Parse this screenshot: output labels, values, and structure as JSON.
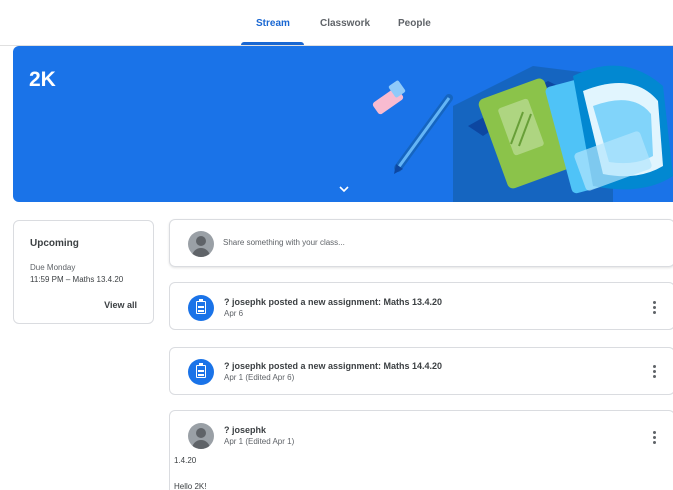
{
  "nav": {
    "tabs": [
      {
        "label": "Stream"
      },
      {
        "label": "Classwork"
      },
      {
        "label": "People"
      }
    ],
    "active_color": "#1967d2"
  },
  "banner": {
    "title": "2K",
    "color": "#1a73e8",
    "expand_icon": "chevron-down-icon"
  },
  "upcoming": {
    "title": "Upcoming",
    "due": "Due Monday",
    "item": "11:59 PM – Maths 13.4.20",
    "view_all": "View all"
  },
  "share": {
    "placeholder": "Share something with your class..."
  },
  "posts": [
    {
      "title": "? josephk posted a new assignment: Maths 13.4.20",
      "date": "Apr 6",
      "icon": "assignment-icon"
    },
    {
      "title": "? josephk posted a new assignment: Maths 14.4.20",
      "date": "Apr 1 (Edited Apr 6)",
      "icon": "assignment-icon"
    },
    {
      "author": "? josephk",
      "date": "Apr 1 (Edited Apr 1)",
      "body": [
        "1.4.20",
        "Hello 2K!"
      ],
      "icon": "avatar-icon"
    }
  ]
}
